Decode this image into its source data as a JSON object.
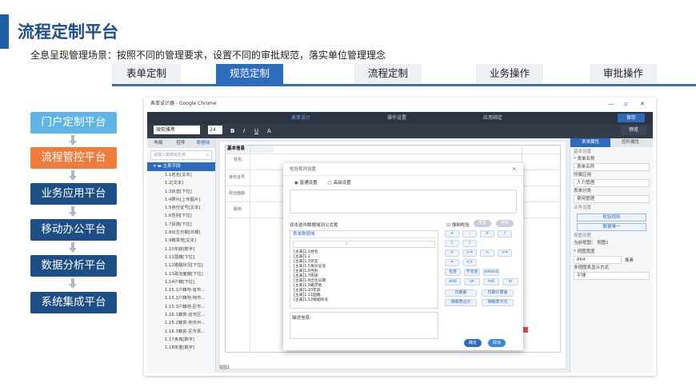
{
  "slide": {
    "title": "流程定制平台",
    "subtitle": "全息呈现管理场景：按照不同的管理要求，设置不同的审批规范，落实单位管理理念"
  },
  "top_tabs": [
    {
      "label": "表单定制",
      "active": false
    },
    {
      "label": "规范定制",
      "active": true
    },
    {
      "label": "流程定制",
      "active": false
    },
    {
      "label": "业务操作",
      "active": false
    },
    {
      "label": "审批操作",
      "active": false
    }
  ],
  "side_buttons": [
    {
      "label": "门户定制平台",
      "style": "cyan"
    },
    {
      "label": "流程管控平台",
      "style": "orange"
    },
    {
      "label": "业务应用平台",
      "style": "navy"
    },
    {
      "label": "移动办公平台",
      "style": "navy"
    },
    {
      "label": "数据分析平台",
      "style": "navy"
    },
    {
      "label": "系统集成平台",
      "style": "navy"
    }
  ],
  "browser": {
    "window_title": "表单设计器 - Google Chrome",
    "steps": [
      "表单设计",
      "操作设置",
      "应用绑定"
    ],
    "save_label": "保存",
    "preview_label": "预览",
    "font_select": "微软雅黑",
    "font_size": "24"
  },
  "left_pane": {
    "tabs": [
      "布局",
      "控件",
      "数据域"
    ],
    "search_placeholder": "请输入数据域名称",
    "root": "主表字段",
    "items": [
      "1.1姓名[文本]",
      "1.2[文本]",
      "1.3状态[下拉]",
      "1.4照片[上传图片]",
      "1.5身份证号[文本]",
      "1.6性别[下拉]",
      "1.7民族[下拉]",
      "1.8出生日期[日期]",
      "1.9籍贯地[文本]",
      "1.10年龄[数字]",
      "1.11国籍[下拉]",
      "1.12婚姻状况[下拉]",
      "1.13政治面貌[下拉]",
      "1.14户籍[下拉]",
      "1.15.1户籍地-省市...",
      "1.15.2户籍地-地市...",
      "1.15.3户籍地-区市...",
      "1.16.1籍贯-省市区...",
      "1.16.2籍贯-地市州...",
      "1.16.3籍贯-区市县...",
      "1.17身高[数字]",
      "1.18体重[数字]"
    ],
    "footer": "视图1"
  },
  "right_pane": {
    "tabs": [
      "表单属性",
      "控件属性"
    ],
    "base_section": "基本设置",
    "name_label": "* 表单名称",
    "name_value": "表单名称",
    "app_label": "所属应用",
    "app_value": "人力管理",
    "category_label": "表单分类",
    "category_value": "费用管理",
    "rules_section": "业务设置",
    "rule_btn": "校验规则",
    "data_btn": "数据唯一",
    "view_section": "视图设置",
    "current_view": "当前视图：  视图1",
    "width_label": "* 视图宽度",
    "width_value": "864",
    "width_unit": "像素",
    "layout_label": "多视图表显示方式",
    "layout_value": "平铺"
  },
  "canvas": {
    "section_title": "基本信息",
    "labels": [
      "姓名:",
      "身份证号:",
      "政治面貌:",
      "服务:"
    ]
  },
  "modal": {
    "title": "校验规则设置",
    "radio1": "普通设置",
    "radio2": "高级设置",
    "formula_label": "双击选中数据域到公式框",
    "list_header": "表单数据域",
    "fields": [
      "[主表]1.1姓名",
      "[主表]1.2",
      "[主表]1.3状态",
      "[主表]1.5身份证号",
      "[主表]1.6性别",
      "[主表]1.7民族",
      "[主表]1.8出生日期",
      "[主表]1.9籍贯地",
      "[主表]1.10年龄",
      "[主表]1.11国籍",
      "[主表]1.12婚姻状况"
    ],
    "desc_label": "描述信息:",
    "check_label": "强制校验",
    "btn_reset": "重置",
    "btn_verify": "审核",
    "ops_row1": [
      "+",
      "-",
      "×",
      "/"
    ],
    "ops_row2": [
      "(",
      ")"
    ],
    "ops_row3": [
      ">",
      ">=",
      "<",
      "<="
    ],
    "ops_row4": [
      "=",
      "<>"
    ],
    "ops_row5": [
      "包含",
      "不包含",
      "extend"
    ],
    "ops_row6": [
      "and",
      "or",
      "not",
      "in"
    ],
    "fn_row1": [
      "日期差",
      "日期计算差"
    ],
    "fn_row2": [
      "明细表合计",
      "明细表平均"
    ],
    "ok": "确定",
    "cancel": "取消"
  },
  "colors": {
    "navy": "#1d4f86",
    "cyan": "#5fb4e6",
    "orange": "#f07c3b",
    "accent": "#2f6bbd"
  }
}
